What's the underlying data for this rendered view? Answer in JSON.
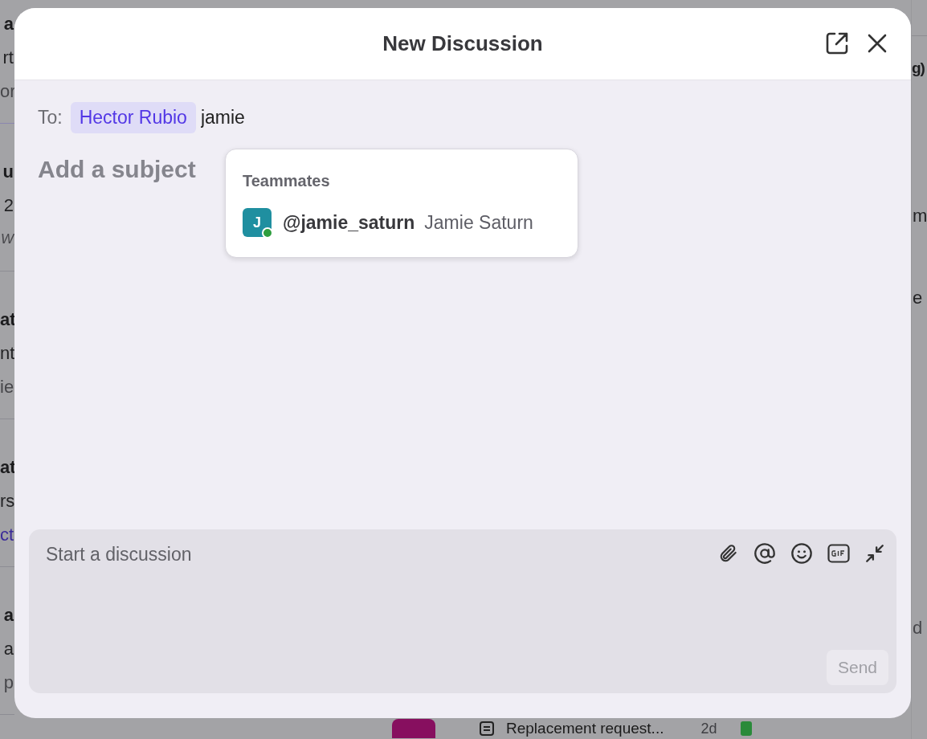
{
  "background": {
    "left_column": [
      {
        "lines": [
          {
            "text": "a",
            "kind": "bold"
          },
          {
            "text": "rt",
            "kind": "plain"
          },
          {
            "text": "or",
            "kind": "muted"
          }
        ]
      },
      {
        "lines": [
          {
            "text": "u",
            "kind": "bold"
          },
          {
            "text": "2",
            "kind": "plain"
          },
          {
            "text": "W",
            "kind": "italic"
          }
        ]
      },
      {
        "lines": [
          {
            "text": "at",
            "kind": "bold"
          },
          {
            "text": "nt",
            "kind": "plain"
          },
          {
            "text": "ie",
            "kind": "muted"
          }
        ]
      },
      {
        "lines": [
          {
            "text": "at",
            "kind": "bold"
          },
          {
            "text": "rs",
            "kind": "plain"
          },
          {
            "text": "ct",
            "kind": "link"
          }
        ]
      },
      {
        "lines": [
          {
            "text": "a",
            "kind": "bold"
          },
          {
            "text": "a",
            "kind": "plain"
          },
          {
            "text": "p",
            "kind": "muted"
          }
        ]
      }
    ],
    "right_column": [
      {
        "text": "g)",
        "kind": "bold"
      },
      {
        "text": "m",
        "kind": "plain"
      },
      {
        "text": "e",
        "kind": "plain"
      },
      {
        "text": "d",
        "kind": "muted"
      }
    ],
    "bottom_row": {
      "title": "Replacement request...",
      "age": "2d"
    }
  },
  "modal": {
    "title": "New Discussion",
    "to": {
      "label": "To:",
      "recipients": [
        {
          "name": "Hector Rubio"
        }
      ],
      "value": "jamie"
    },
    "subject": {
      "placeholder": "Add a subject"
    },
    "suggestions": {
      "heading": "Teammates",
      "items": [
        {
          "initial": "J",
          "handle": "@jamie_saturn",
          "name": "Jamie Saturn",
          "online": true
        }
      ]
    },
    "composer": {
      "placeholder": "Start a discussion",
      "send": {
        "label": "Send",
        "disabled": true
      }
    }
  }
}
